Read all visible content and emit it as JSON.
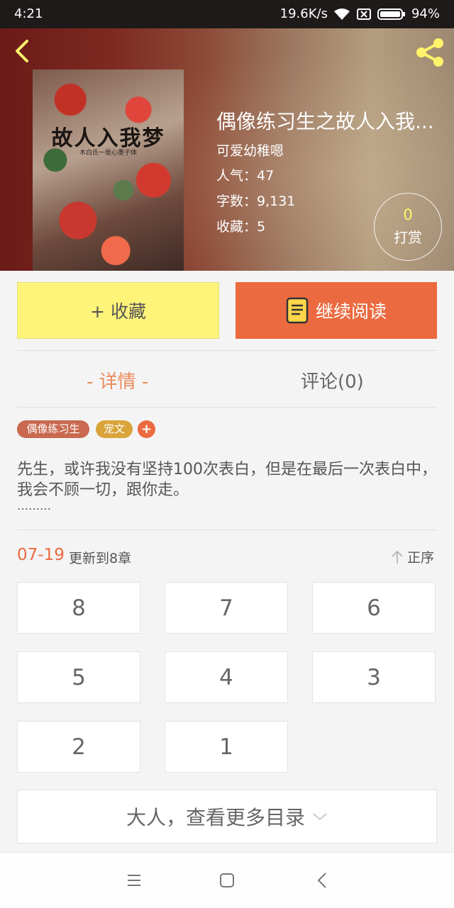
{
  "status_bar": {
    "time": "4:21",
    "network_speed": "19.6K/s",
    "battery": "94%"
  },
  "book": {
    "title": "偶像练习生之故人入我...",
    "author": "可爱幼稚嗯",
    "popularity": "人气：47",
    "word_count": "字数：9,131",
    "favorites": "收藏：5",
    "cover_title": "故人入我梦",
    "cover_subtitle": "木白氏一是心墨子体"
  },
  "reward": {
    "count": "0",
    "label": "打赏"
  },
  "actions": {
    "favorite_label": "+ 收藏",
    "continue_label": "继续阅读"
  },
  "tabs": {
    "details": "- 详情 -",
    "comments": "评论(0)"
  },
  "tags": [
    "偶像练习生",
    "宠文"
  ],
  "add_tag_label": "+",
  "description": {
    "text": "先生，或许我没有坚持100次表白，但是在最后一次表白中，我会不顾一切，跟你走。",
    "ellipsis": "………"
  },
  "update": {
    "date": "07-19",
    "text": "更新到8章",
    "order_label": "正序"
  },
  "chapters": [
    "8",
    "7",
    "6",
    "5",
    "4",
    "3",
    "2",
    "1"
  ],
  "more_catalog": "大人，查看更多目录",
  "colors": {
    "accent": "#eb6a3f",
    "favorite_bg": "#fff47a",
    "tag1": "#c9694f",
    "tag2": "#d9a43a"
  }
}
